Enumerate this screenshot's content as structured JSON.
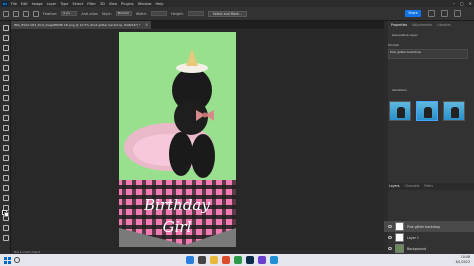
{
  "app": {
    "logo_text": "Ps",
    "menu": [
      "File",
      "Edit",
      "Image",
      "Layer",
      "Type",
      "Select",
      "Filter",
      "3D",
      "View",
      "Plugins",
      "Window",
      "Help"
    ]
  },
  "options_bar": {
    "feather_label": "Feather:",
    "feather_value": "0 px",
    "antialias_label": "Anti-alias",
    "style_label": "Style:",
    "style_value": "Normal",
    "width_label": "Width:",
    "height_label": "Height:",
    "select_mask_label": "Select and Mask...",
    "share_label": "Share"
  },
  "document": {
    "tab_title": "IMG_8522-CR3_DxO_DeepPRIME XD.png @ 12.5% (Pink glitter backdrop, RGB/16*) *",
    "close_glyph": "×",
    "status_text": "Not a smart object"
  },
  "properties": {
    "tabs": [
      "Properties",
      "Adjustments",
      "Libraries"
    ],
    "layer_type": "Generative Layer",
    "prompt_label": "Prompt",
    "prompt_value": "Pink glitter backdrop",
    "variations_label": "Variations"
  },
  "layers": {
    "tabs": [
      "Layers",
      "Channels",
      "Paths"
    ],
    "rows": [
      {
        "name": "Pink glitter backdrop",
        "selected": true
      },
      {
        "name": "Layer 1",
        "selected": false
      },
      {
        "name": "Background",
        "selected": false
      }
    ]
  },
  "taskbar": {
    "time": "10:08",
    "date": "6/1/2023"
  },
  "colors": {
    "accent": "#1473e6",
    "canvas_green": "#98e08e",
    "bandana_pink": "#f07bb0"
  }
}
